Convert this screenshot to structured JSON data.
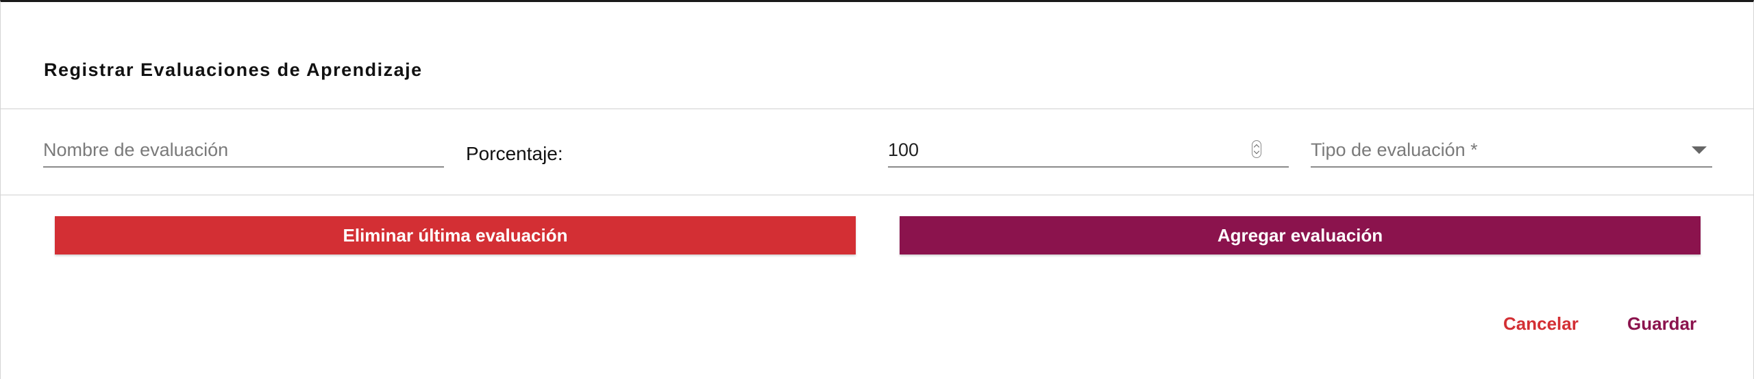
{
  "dialog": {
    "title": "Registrar Evaluaciones de Aprendizaje"
  },
  "form": {
    "nombre": {
      "placeholder": "Nombre de evaluación",
      "value": ""
    },
    "porcentaje_label": "Porcentaje:",
    "porcentaje": {
      "value": "100"
    },
    "tipo": {
      "placeholder": "Tipo de evaluación *",
      "value": ""
    }
  },
  "actions": {
    "delete_label": "Eliminar última evaluación",
    "add_label": "Agregar evaluación",
    "cancel_label": "Cancelar",
    "save_label": "Guardar"
  },
  "colors": {
    "danger": "#d32f34",
    "primary": "#8b134d"
  },
  "icons": [
    "number-spinner-icon",
    "dropdown-arrow-icon"
  ]
}
